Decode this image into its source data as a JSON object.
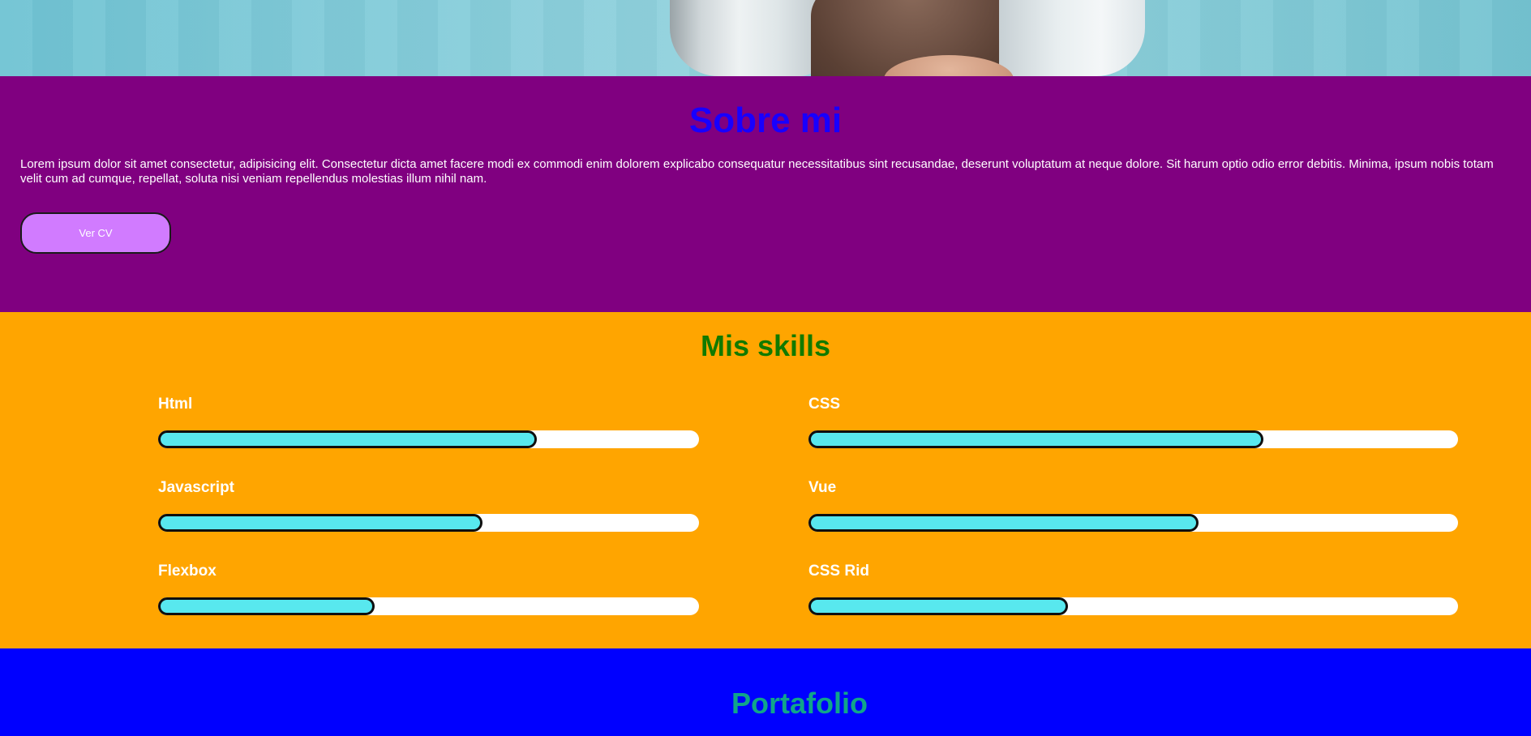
{
  "about": {
    "title": "Sobre mi",
    "text": "Lorem ipsum dolor sit amet consectetur, adipisicing elit. Consectetur dicta amet facere modi ex commodi enim dolorem explicabo consequatur necessitatibus sint recusandae, deserunt voluptatum at neque dolore. Sit harum optio odio error debitis. Minima, ipsum nobis totam velit cum ad cumque, repellat, soluta nisi veniam repellendus molestias illum nihil nam.",
    "button_label": "Ver CV"
  },
  "skills": {
    "title": "Mis skills",
    "items": [
      {
        "name": "Html",
        "level": 0.7
      },
      {
        "name": "CSS",
        "level": 0.7
      },
      {
        "name": "Javascript",
        "level": 0.6
      },
      {
        "name": "Vue",
        "level": 0.6
      },
      {
        "name": "Flexbox",
        "level": 0.4
      },
      {
        "name": "CSS Rid",
        "level": 0.4
      }
    ]
  },
  "portfolio": {
    "title": "Portafolio"
  },
  "colors": {
    "about_bg": "#800080",
    "about_title": "#1800ff",
    "button_bg": "#d17bff",
    "skills_bg": "#ffa500",
    "skills_title": "#117a00",
    "bar_fill": "#58e8ee",
    "portfolio_bg": "#0000ff",
    "portfolio_title": "#10a58a"
  }
}
